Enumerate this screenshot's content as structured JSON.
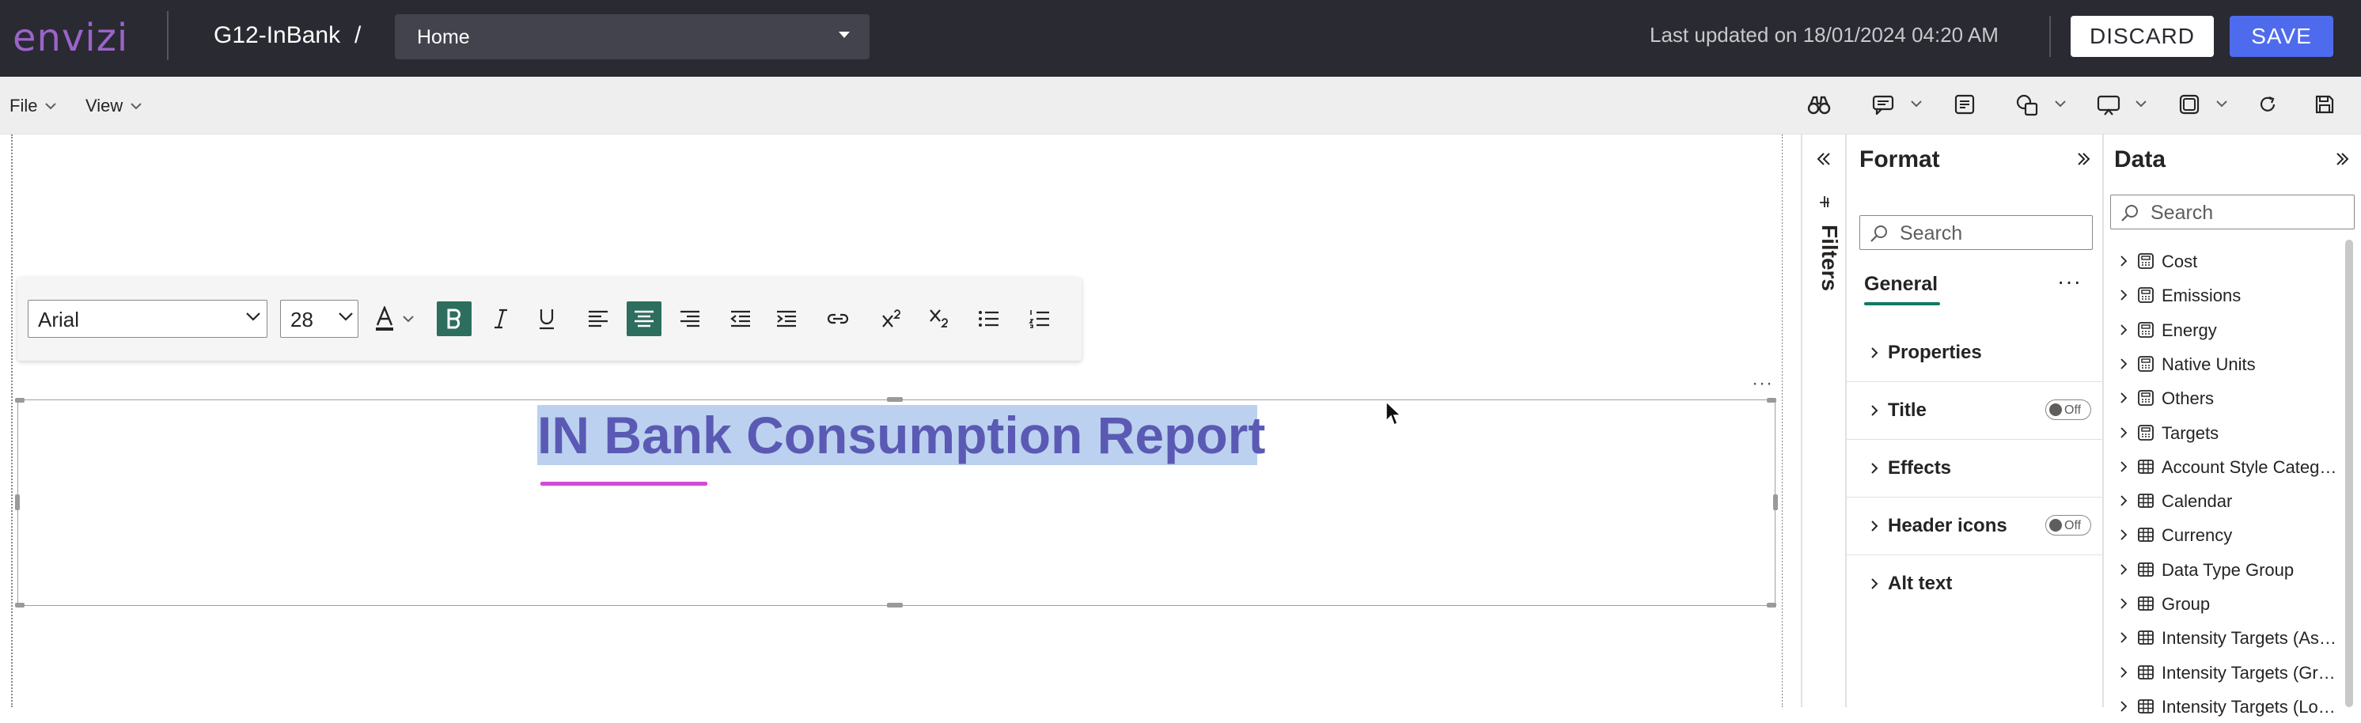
{
  "app": {
    "logo": "envizi",
    "report_name": "G12-InBank",
    "breadcrumb_separator": "/",
    "page_select": "Home",
    "last_updated": "Last updated on 18/01/2024 04:20 AM",
    "discard_label": "DISCARD",
    "save_label": "SAVE"
  },
  "menubar": {
    "items": [
      {
        "label": "File"
      },
      {
        "label": "View"
      }
    ],
    "toolbar_icons": [
      "binoculars-icon",
      "comment-icon",
      "textbox-icon",
      "shapes-icon",
      "present-icon",
      "layout-icon",
      "refresh-icon",
      "save-icon"
    ]
  },
  "text_toolbar": {
    "font": "Arial",
    "size": "28",
    "bold_active": true,
    "align_center_active": true
  },
  "visual": {
    "title": "IN Bank Consumption Report",
    "more_label": "···"
  },
  "filters": {
    "label": "Filters"
  },
  "format_pane": {
    "title": "Format",
    "search_placeholder": "Search",
    "tab": "General",
    "more_label": "···",
    "sections": [
      {
        "label": "Properties",
        "toggle": null
      },
      {
        "label": "Title",
        "toggle": "Off"
      },
      {
        "label": "Effects",
        "toggle": null
      },
      {
        "label": "Header icons",
        "toggle": "Off"
      },
      {
        "label": "Alt text",
        "toggle": null
      }
    ]
  },
  "data_pane": {
    "title": "Data",
    "search_placeholder": "Search",
    "fields": [
      {
        "label": "Cost",
        "icon": "calculator-table-icon"
      },
      {
        "label": "Emissions",
        "icon": "calculator-table-icon"
      },
      {
        "label": "Energy",
        "icon": "calculator-table-icon"
      },
      {
        "label": "Native Units",
        "icon": "calculator-table-icon"
      },
      {
        "label": "Others",
        "icon": "calculator-table-icon"
      },
      {
        "label": "Targets",
        "icon": "calculator-table-icon"
      },
      {
        "label": "Account Style Category",
        "icon": "table-icon"
      },
      {
        "label": "Calendar",
        "icon": "table-icon"
      },
      {
        "label": "Currency",
        "icon": "table-icon"
      },
      {
        "label": "Data Type Group",
        "icon": "table-icon"
      },
      {
        "label": "Group",
        "icon": "table-icon"
      },
      {
        "label": "Intensity Targets (Ass...",
        "icon": "table-icon"
      },
      {
        "label": "Intensity Targets (Gro...",
        "icon": "table-icon"
      },
      {
        "label": "Intensity Targets (Loca...",
        "icon": "table-icon"
      }
    ]
  },
  "colors": {
    "topbar": "#2a2a32",
    "brand": "#9b64c8",
    "save": "#4f6bed",
    "title_text": "#5a5ab4",
    "selection": "#bcd1ef",
    "accent": "#117865"
  }
}
